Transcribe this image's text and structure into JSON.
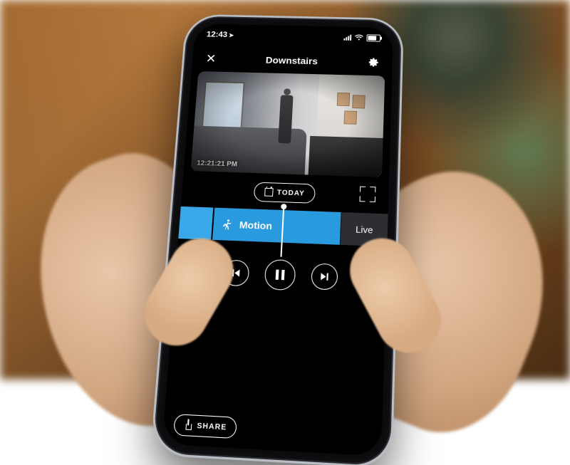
{
  "statusbar": {
    "time": "12:43",
    "location_indicator": "➤"
  },
  "header": {
    "title": "Downstairs"
  },
  "feed": {
    "timestamp": "12:21:21 PM"
  },
  "date_picker": {
    "label": "TODAY"
  },
  "timeline": {
    "event_label": "Motion",
    "live_label": "Live",
    "accent_color": "#2a9ade"
  },
  "controls": {
    "share_label": "SHARE"
  }
}
